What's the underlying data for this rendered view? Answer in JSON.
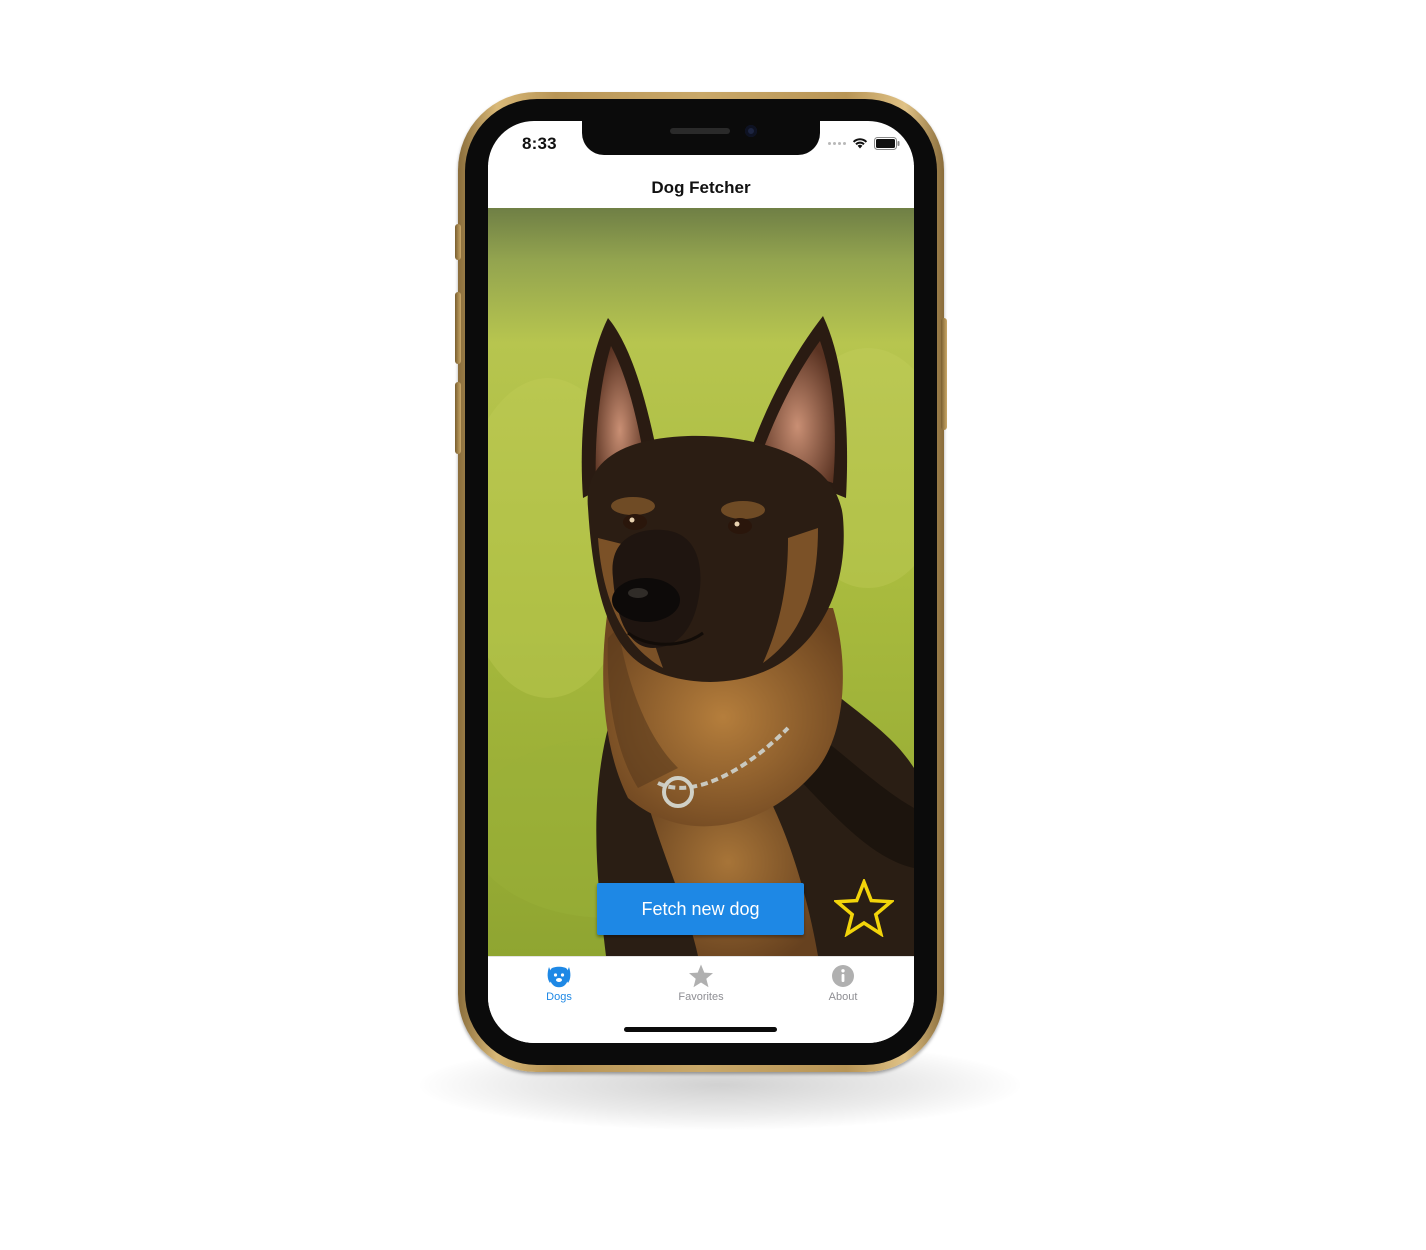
{
  "status_bar": {
    "time": "8:33"
  },
  "nav": {
    "title": "Dog Fetcher"
  },
  "main": {
    "photo_subject": "german-shepherd-dog-photo",
    "fetch_button_label": "Fetch new dog",
    "favorite_icon": "star-outline-icon",
    "favorite_color": "#f2d40a",
    "button_color": "#1e88e5"
  },
  "tabs": [
    {
      "label": "Dogs",
      "icon": "dog-face-icon",
      "active": true
    },
    {
      "label": "Favorites",
      "icon": "star-icon",
      "active": false
    },
    {
      "label": "About",
      "icon": "info-icon",
      "active": false
    }
  ],
  "colors": {
    "active_tab": "#1e88e5",
    "inactive_tab": "#8e8e93",
    "phone_frame": "#c9a869"
  }
}
